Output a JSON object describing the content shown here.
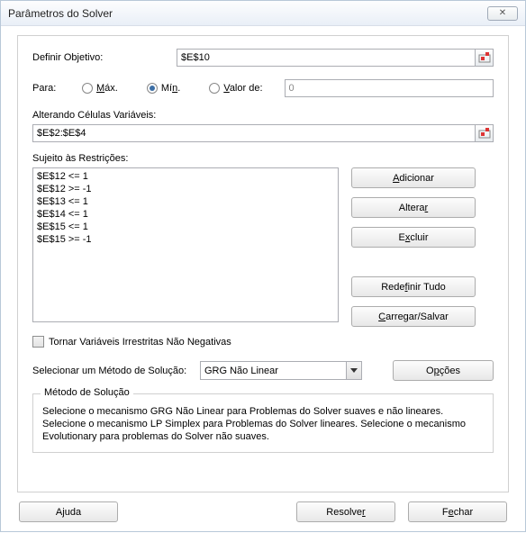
{
  "window": {
    "title": "Parâmetros do Solver"
  },
  "objective": {
    "label": "Definir Objetivo:",
    "value": "$E$10"
  },
  "para": {
    "label": "Para:",
    "max": "Máx.",
    "min": "Mín.",
    "valorDe": "Valor de:",
    "valorDeInput": "0",
    "selected": "min"
  },
  "vars": {
    "label": "Alterando Células Variáveis:",
    "value": "$E$2:$E$4"
  },
  "constraints": {
    "label": "Sujeito às Restrições:",
    "items": [
      "$E$12 <= 1",
      "$E$12 >= -1",
      "$E$13 <= 1",
      "$E$14 <= 1",
      "$E$15 <= 1",
      "$E$15 >= -1"
    ]
  },
  "buttons": {
    "adicionar": "Adicionar",
    "alterar": "Alterar",
    "excluir": "Excluir",
    "redefinir": "Redefinir Tudo",
    "carregar": "Carregar/Salvar",
    "opcoes": "Opções",
    "ajuda": "Ajuda",
    "resolver": "Resolver",
    "fechar": "Fechar"
  },
  "checkbox": {
    "label": "Tornar Variáveis Irrestritas Não Negativas"
  },
  "method": {
    "label": "Selecionar um Método de Solução:",
    "value": "GRG Não Linear"
  },
  "info": {
    "title": "Método de Solução",
    "text": "Selecione o mecanismo GRG Não Linear para Problemas do Solver suaves e não lineares. Selecione o mecanismo LP Simplex para Problemas do Solver lineares. Selecione o mecanismo Evolutionary para problemas do Solver não suaves."
  }
}
